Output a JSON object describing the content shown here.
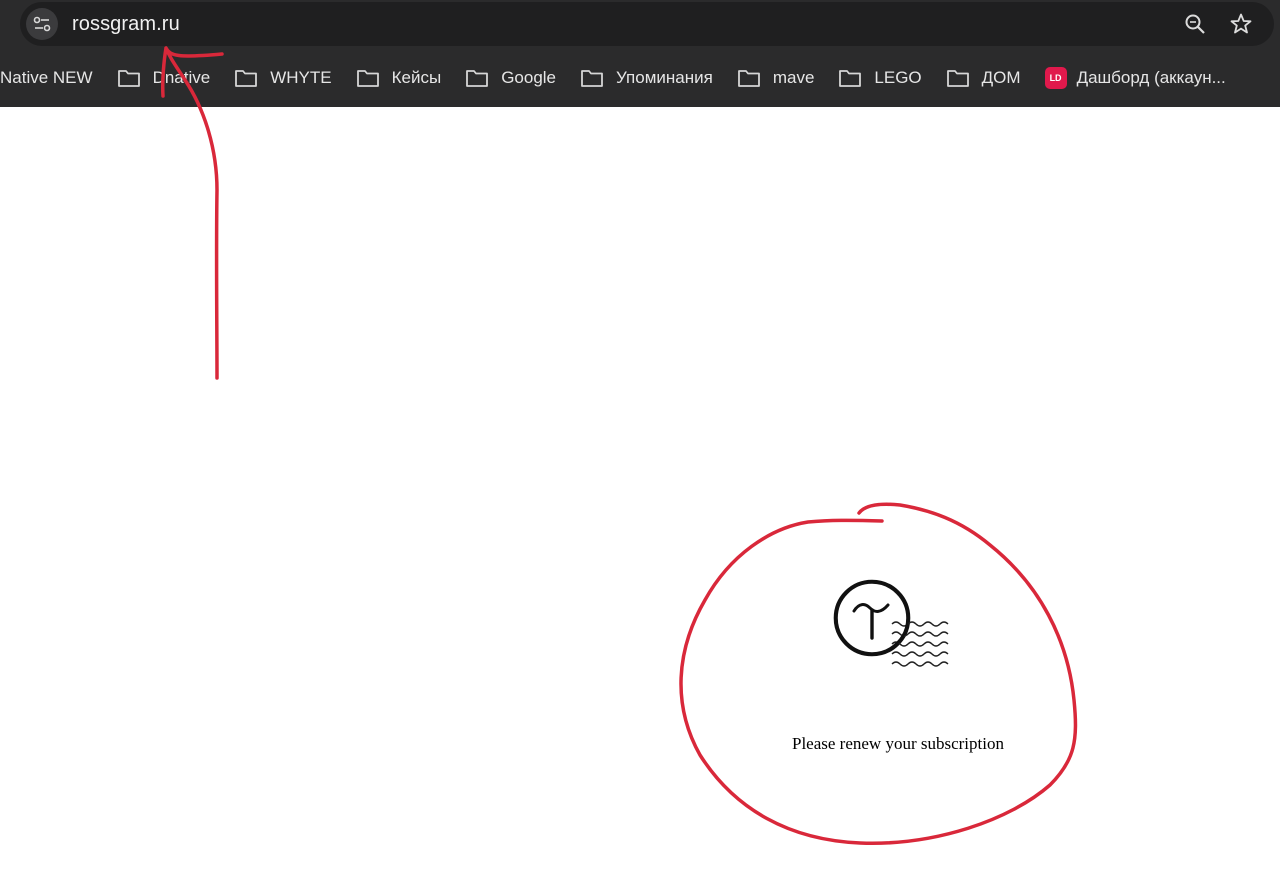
{
  "browser": {
    "address_bar": {
      "url": "rossgram.ru"
    },
    "bookmarks": [
      {
        "label": "Native NEW",
        "type": "link"
      },
      {
        "label": "Dnative",
        "type": "folder"
      },
      {
        "label": "WHYTE",
        "type": "folder"
      },
      {
        "label": "Кейсы",
        "type": "folder"
      },
      {
        "label": "Google",
        "type": "folder"
      },
      {
        "label": "Упоминания",
        "type": "folder"
      },
      {
        "label": "mave",
        "type": "folder"
      },
      {
        "label": "LEGO",
        "type": "folder"
      },
      {
        "label": "ДОМ",
        "type": "folder"
      },
      {
        "label": "Дашборд (аккаун...",
        "type": "link",
        "badge": "LD"
      }
    ]
  },
  "page": {
    "message": "Please renew your subscription",
    "logo_icon": "tilda-logo-icon"
  },
  "annotations": {
    "color": "#d9283a",
    "items": [
      "arrow-pointing-to-url",
      "circle-around-notice"
    ]
  }
}
